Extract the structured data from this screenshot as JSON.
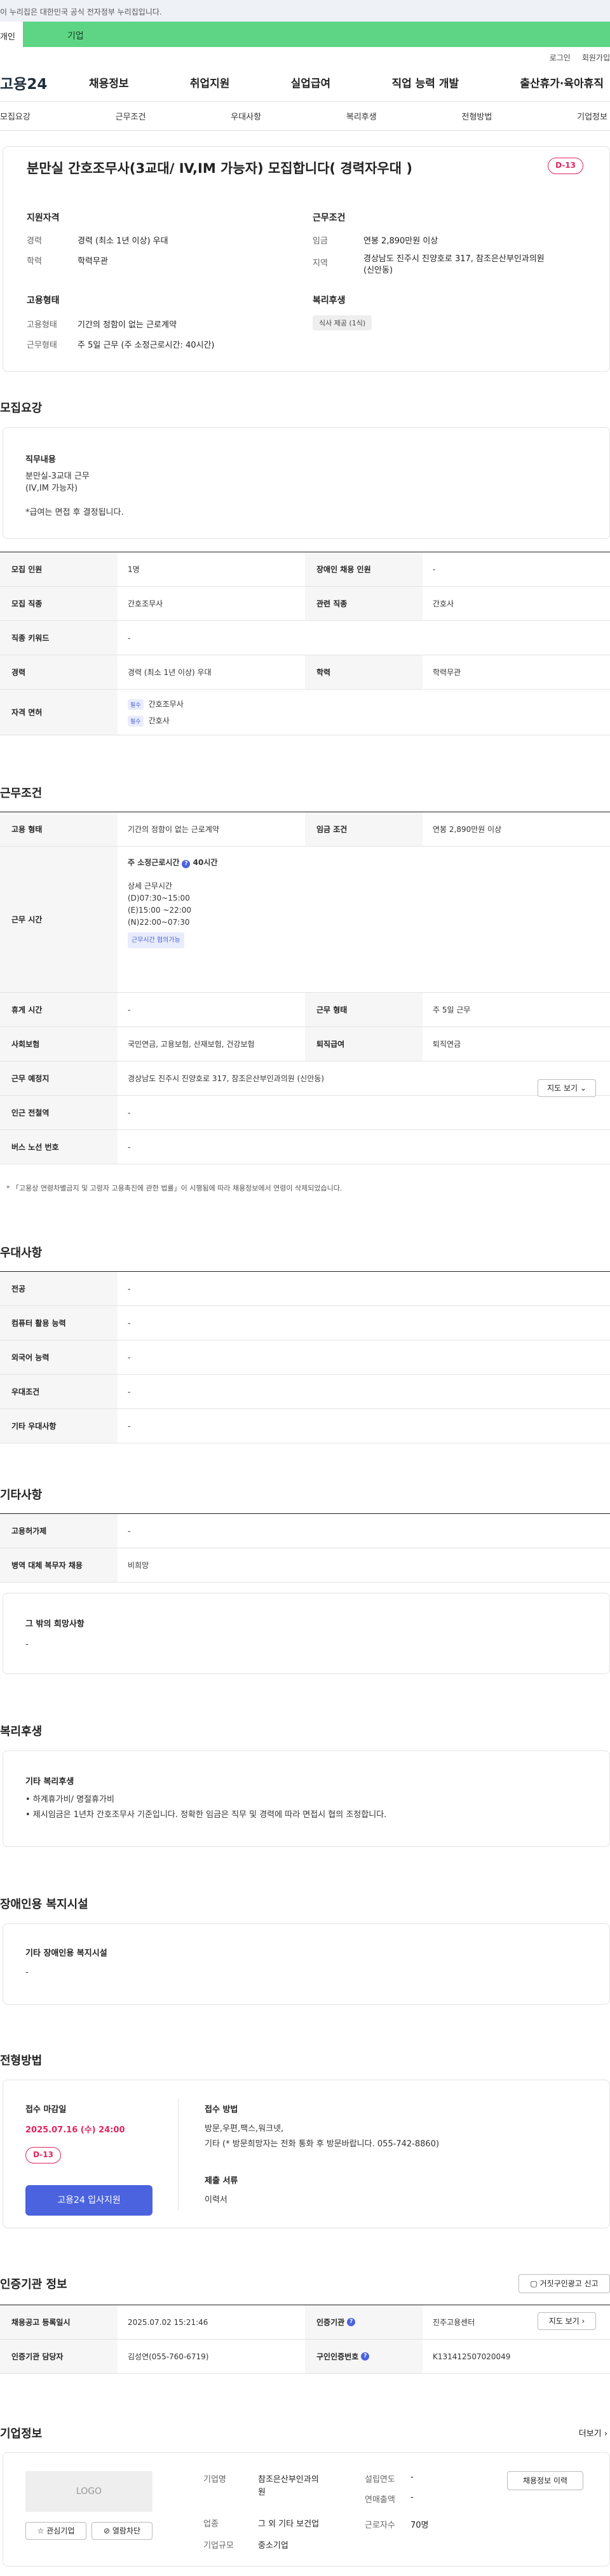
{
  "gov_banner": "이 누리집은 대한민국 공식 전자정부 누리집입니다.",
  "tabs": {
    "personal": "개인",
    "company": "기업"
  },
  "utility": {
    "login": "로그인",
    "signup": "회원가입"
  },
  "logo": "고용24",
  "gnb": [
    "채용정보",
    "취업지원",
    "실업급여",
    "직업 능력 개발",
    "출산휴가·육아휴직"
  ],
  "subnav": [
    "모집요강",
    "근무조건",
    "우대사항",
    "복리후생",
    "전형방법",
    "기업정보"
  ],
  "summary": {
    "title": "분만실 간호조무사(3교대/ IV,IM 가능자) 모집합니다( 경력자우대 )",
    "dday": "D-13",
    "qual_heading": "지원자격",
    "career_k": "경력",
    "career_v": "경력 (최소 1년 이상) 우대",
    "edu_k": "학력",
    "edu_v": "학력무관",
    "cond_heading": "근무조건",
    "wage_k": "임금",
    "wage_v": "연봉 2,890만원 이상",
    "region_k": "지역",
    "region_v1": "경상남도 진주시 진양호로 317, 참조은산부인과의원",
    "region_v2": "(신안동)",
    "emp_heading": "고용형태",
    "emptype_k": "고용형태",
    "emptype_v": "기간의 정함이 없는 근로계약",
    "worktype_k": "근무형태",
    "worktype_v": "주 5일 근무 (주 소정근로시간: 40시간)",
    "welfare_heading": "복리후생",
    "welfare_tag": "식사 제공 (1식)"
  },
  "recruit": {
    "heading": "모집요강",
    "duty_label": "직무내용",
    "duty_lines": [
      "분만실-3교대 근무",
      "(IV,IM 가능자)",
      "",
      "*급여는 면접 후 결정됩니다."
    ],
    "rows": {
      "headcount_k": "모집 인원",
      "headcount_v": "1명",
      "disabled_k": "장애인 채용 인원",
      "disabled_v": "-",
      "job_k": "모집 직종",
      "job_v": "간호조무사",
      "related_k": "관련 직종",
      "related_v": "간호사",
      "keyword_k": "직종 키워드",
      "keyword_v": "-",
      "career_k": "경력",
      "career_v": "경력 (최소 1년 이상) 우대",
      "edu_k": "학력",
      "edu_v": "학력무관",
      "license_k": "자격 면허",
      "required": "필수",
      "license_1": "간호조무사",
      "license_2": "간호사"
    }
  },
  "conditions": {
    "heading": "근무조건",
    "emp_k": "고용 형태",
    "emp_v": "기간의 정함이 없는 근로계약",
    "wage_k": "임금 조건",
    "wage_v": "연봉 2,890만원 이상",
    "hours_k": "근무 시간",
    "hours_total": "주 소정근로시간",
    "hours_value": "40시간",
    "detail_label": "상세 근무시간",
    "detail_1": "(D)07:30~15:00",
    "detail_2": "(E)15:00 ~22:00",
    "detail_3": "(N)22:00~07:30",
    "chip": "근무시간 협의가능",
    "break_k": "휴게 시간",
    "break_v": "-",
    "form_k": "근무 형태",
    "form_v": "주 5일 근무",
    "insurance_k": "사회보험",
    "insurance_v": "국민연금, 고용보험, 산재보험, 건강보험",
    "severance_k": "퇴직급여",
    "severance_v": "퇴직연금",
    "place_k": "근무 예정지",
    "place_v": "경상남도 진주시 진양호로 317, 참조은산부인과의원 (신안동)",
    "map_btn": "지도 보기",
    "subway_k": "인근 전철역",
    "subway_v": "-",
    "bus_k": "버스 노선 번호",
    "bus_v": "-",
    "note": "* 「고용상 연령차별금지 및 고령자 고용촉진에 관한 법률」이 시행됨에 따라 채용정보에서 연령이 삭제되었습니다."
  },
  "preference": {
    "heading": "우대사항",
    "major_k": "전공",
    "major_v": "-",
    "pc_k": "컴퓨터 활용 능력",
    "pc_v": "-",
    "lang_k": "외국어 능력",
    "lang_v": "-",
    "cond_k": "우대조건",
    "cond_v": "-",
    "etc_k": "기타 우대사항",
    "etc_v": "-"
  },
  "other": {
    "heading": "기타사항",
    "permit_k": "고용허가제",
    "permit_v": "-",
    "military_k": "병역 대체 복무자 채용",
    "military_v": "비희망",
    "wish_label": "그 밖의 희망사항",
    "wish_v": "-"
  },
  "welfare": {
    "heading": "복리후생",
    "label": "기타 복리후생",
    "line1": "• 하계휴가비/ 명절휴가비",
    "line2": "• 제시임금은 1년차 간호조무사 기준입니다. 정확한 임금은 직무 및 경력에 따라 면접시 협의 조정합니다."
  },
  "disabled_facility": {
    "heading": "장애인용 복지시설",
    "label": "기타 장애인용 복지시설",
    "value": "-"
  },
  "process": {
    "heading": "전형방법",
    "deadline_label": "접수 마감일",
    "deadline": "2025.07.16 (수) 24:00",
    "dday": "D-13",
    "apply_btn": "고용24 입사지원",
    "method_label": "접수 방법",
    "method_line1": "방문,우편,팩스,워크넷,",
    "method_line2": "기타 (* 방문희망자는 전화 통화 후 방문바랍니다. 055-742-8860)",
    "docs_label": "제출 서류",
    "docs_v": "이력서"
  },
  "agency": {
    "heading": "인증기관 정보",
    "report_btn": "거짓구인광고 신고",
    "reg_k": "채용공고 등록일시",
    "reg_v": "2025.07.02 15:21:46",
    "org_k": "인증기관",
    "org_v": "진주고용센터",
    "map_btn": "지도 보기",
    "manager_k": "인증기관 담당자",
    "manager_v": "김성연(055-760-6719)",
    "job_id_k": "구인인증번호",
    "job_id_v": "K131412507020049"
  },
  "company": {
    "heading": "기업정보",
    "more": "더보기",
    "logo": "LOGO",
    "interest_btn": "관심기업",
    "block_btn": "열람차단",
    "name_k": "기업명",
    "name_v1": "참조은산부인과의",
    "name_v2": "원",
    "industry_k": "업종",
    "industry_v": "그 외 기타 보건업",
    "size_k": "기업규모",
    "size_v": "중소기업",
    "founded_k": "설립연도",
    "founded_v": "-",
    "sales_k": "연매출액",
    "sales_v": "-",
    "employees_k": "근로자수",
    "employees_v": "70명",
    "hiring_btn": "채용정보 이력"
  }
}
